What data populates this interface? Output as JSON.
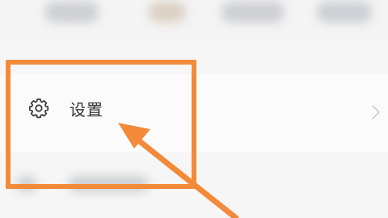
{
  "settings_item": {
    "label": "设置",
    "icon": "gear-icon",
    "chevron_icon": "chevron-right-icon"
  },
  "annotation": {
    "color": "#f28a3a"
  }
}
